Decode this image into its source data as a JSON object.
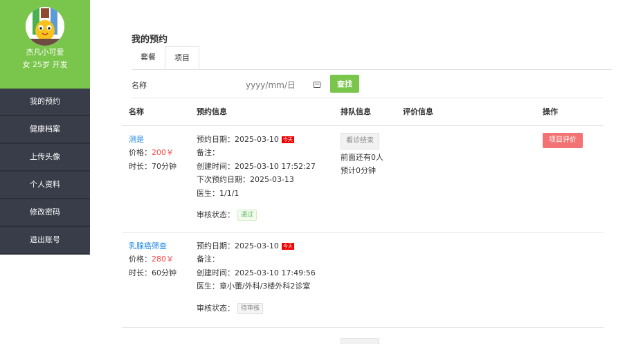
{
  "user": {
    "name": "杰凡小可爱",
    "meta": "女  25岁  开发"
  },
  "menu": [
    "我的预约",
    "健康档案",
    "上传头像",
    "个人资料",
    "修改密码",
    "退出账号"
  ],
  "page": {
    "title": "我的预约"
  },
  "tabs": [
    "套餐",
    "项目"
  ],
  "filter": {
    "label": "名称",
    "date_placeholder": "yyyy/mm/日",
    "search_label": "查找"
  },
  "table": {
    "headers": [
      "名称",
      "预约信息",
      "排队信息",
      "评价信息",
      "操作"
    ],
    "rows": [
      {
        "name": "测是",
        "price_label": "价格：",
        "price": "200￥",
        "duration": "时长：70分钟",
        "appt_date": "预约日期：2025-03-10",
        "today": "今天",
        "remark": "备注：",
        "created": "创建时间：2025-03-10 17:52:27",
        "next_appt": "下次预约日期：2025-03-13",
        "doctor": "医生：1/1/1",
        "audit_label": "审核状态：",
        "audit_status": "通过",
        "visit_btn": "看诊结束",
        "queue_ahead": "前面还有0人",
        "queue_wait": "预计0分钟",
        "action": "项目评价"
      },
      {
        "name": "乳腺癌筛查",
        "price_label": "价格：",
        "price": "280￥",
        "duration": "时长：60分钟",
        "appt_date": "预约日期：2025-03-10",
        "today": "今天",
        "remark": "备注：",
        "created": "创建时间：2025-03-10 17:49:56",
        "doctor": "医生：章小蕾/外科/3楼外科2诊室",
        "audit_label": "审核状态：",
        "audit_status": "待审核"
      }
    ]
  },
  "colors": {
    "accent": "#7ac54c",
    "sidebar": "#393d49",
    "danger": "#f37374",
    "link": "#1e88e5",
    "today": "#e00000"
  }
}
